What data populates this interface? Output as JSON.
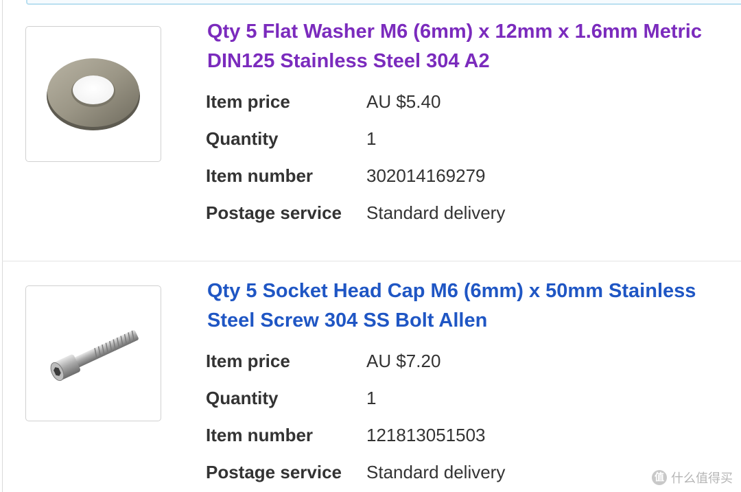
{
  "items": [
    {
      "title": "Qty 5 Flat Washer M6 (6mm) x 12mm x 1.6mm Metric DIN125 Stainless Steel 304 A2",
      "image": "washer-image",
      "details": [
        {
          "label": "Item price",
          "value": "AU $5.40"
        },
        {
          "label": "Quantity",
          "value": "1"
        },
        {
          "label": "Item number",
          "value": "302014169279"
        },
        {
          "label": "Postage service",
          "value": "Standard delivery"
        }
      ]
    },
    {
      "title": "Qty 5 Socket Head Cap M6 (6mm) x 50mm Stainless Steel Screw 304 SS Bolt Allen",
      "image": "screw-image",
      "details": [
        {
          "label": "Item price",
          "value": "AU $7.20"
        },
        {
          "label": "Quantity",
          "value": "1"
        },
        {
          "label": "Item number",
          "value": "121813051503"
        },
        {
          "label": "Postage service",
          "value": "Standard delivery"
        }
      ]
    }
  ],
  "watermark": {
    "badge": "值",
    "text": "什么值得买"
  },
  "colors": {
    "visited_link": "#7b2bbd",
    "link": "#1f56c4",
    "text": "#333333",
    "border": "#d0d0d0"
  }
}
